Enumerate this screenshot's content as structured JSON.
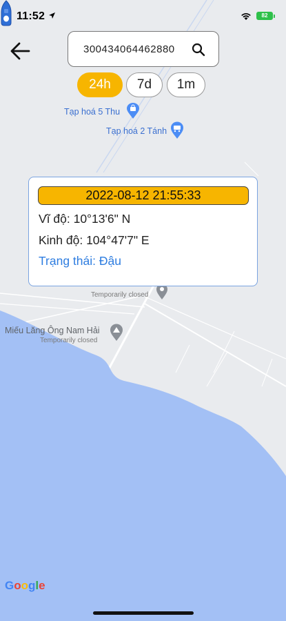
{
  "status_bar": {
    "time": "11:52",
    "battery": "82"
  },
  "search": {
    "value": "300434064462880"
  },
  "time_ranges": [
    {
      "label": "24h",
      "active": true
    },
    {
      "label": "7d",
      "active": false
    },
    {
      "label": "1m",
      "active": false
    }
  ],
  "map": {
    "pois": [
      {
        "name": "Tạp hoá 5 Thu"
      },
      {
        "name": "Tạp hoá 2 Tánh"
      },
      {
        "name": "Miếu Lăng Ông Nam Hải",
        "subtitle": "Temporarily closed"
      },
      {
        "name": "",
        "subtitle": "Temporarily closed"
      }
    ],
    "attribution": "Google"
  },
  "popup": {
    "timestamp": "2022-08-12 21:55:33",
    "latitude": "Vĩ độ: 10°13'6\" N",
    "longitude": "Kinh độ: 104°47'7\" E",
    "status": "Trạng thái: Đậu"
  },
  "colors": {
    "accent": "#f7b500",
    "link": "#2e7de0",
    "water": "#a3c0f5",
    "land": "#e9ebee"
  }
}
